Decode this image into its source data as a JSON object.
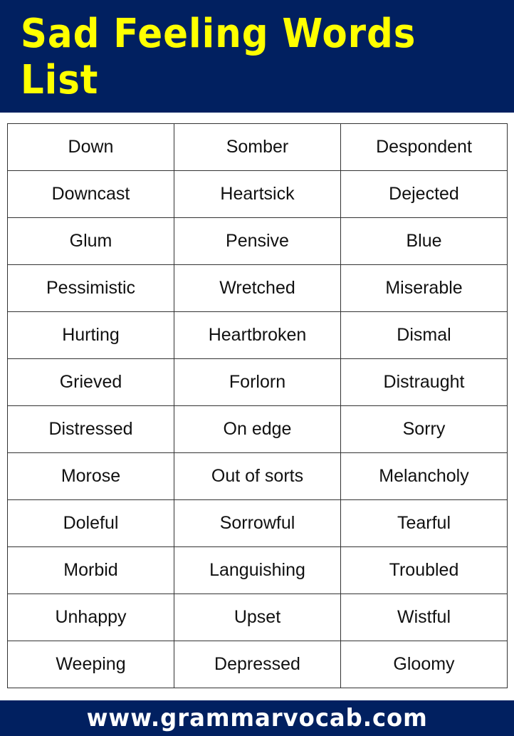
{
  "header": {
    "title": "Sad Feeling Words List",
    "background": "#012060",
    "title_color": "#ffff00"
  },
  "words_table": {
    "rows": [
      [
        "Down",
        "Somber",
        "Despondent"
      ],
      [
        "Downcast",
        "Heartsick",
        "Dejected"
      ],
      [
        "Glum",
        "Pensive",
        "Blue"
      ],
      [
        "Pessimistic",
        "Wretched",
        "Miserable"
      ],
      [
        "Hurting",
        "Heartbroken",
        "Dismal"
      ],
      [
        "Grieved",
        "Forlorn",
        "Distraught"
      ],
      [
        "Distressed",
        "On edge",
        "Sorry"
      ],
      [
        "Morose",
        "Out of sorts",
        "Melancholy"
      ],
      [
        "Doleful",
        "Sorrowful",
        "Tearful"
      ],
      [
        "Morbid",
        "Languishing",
        "Troubled"
      ],
      [
        "Unhappy",
        "Upset",
        "Wistful"
      ],
      [
        "Weeping",
        "Depressed",
        "Gloomy"
      ]
    ]
  },
  "footer": {
    "website": "www.grammarvocab.com"
  }
}
